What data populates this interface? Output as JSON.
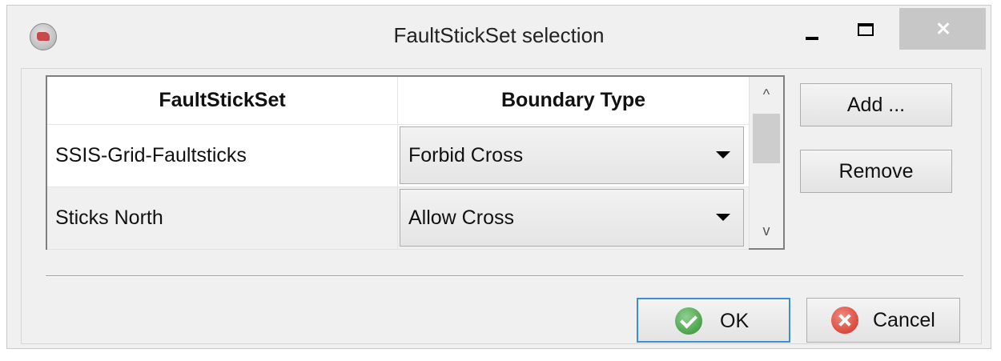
{
  "window": {
    "title": "FaultStickSet selection"
  },
  "table": {
    "columns": [
      "FaultStickSet",
      "Boundary Type"
    ],
    "rows": [
      {
        "name": "SSIS-Grid-Faultsticks",
        "boundary_type": "Forbid Cross"
      },
      {
        "name": "Sticks North",
        "boundary_type": "Allow Cross"
      }
    ],
    "scroll_up_glyph": "^",
    "scroll_down_glyph": "v"
  },
  "side_buttons": {
    "add_label": "Add ...",
    "remove_label": "Remove"
  },
  "footer": {
    "ok_label": "OK",
    "cancel_label": "Cancel"
  },
  "icons": {
    "app": "app-logo-icon",
    "minimize": "minimize-icon",
    "maximize": "maximize-icon",
    "close": "close-icon",
    "ok": "checkmark-icon",
    "cancel": "cancel-x-icon",
    "dropdown": "dropdown-arrow-icon"
  },
  "colors": {
    "ok_focus_border": "#3a8fd6",
    "ok_icon": "#2f8f2f",
    "cancel_icon": "#d22f22",
    "close_button_bg": "#c7c7c7"
  }
}
